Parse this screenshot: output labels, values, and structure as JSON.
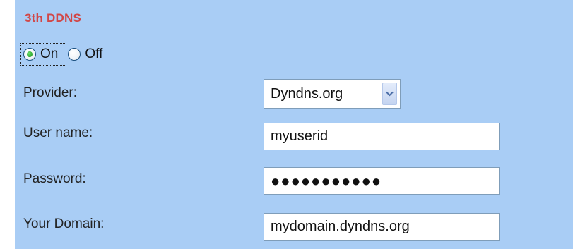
{
  "section": {
    "title": "3th DDNS"
  },
  "radio": {
    "on_label": "On",
    "off_label": "Off",
    "selected": "On"
  },
  "provider": {
    "label": "Provider:",
    "selected": "Dyndns.org"
  },
  "username": {
    "label": "User name:",
    "value": "myuserid"
  },
  "password": {
    "label": "Password:",
    "masked": "●●●●●●●●●●●"
  },
  "domain": {
    "label": "Your Domain:",
    "value": "mydomain.dyndns.org"
  },
  "colors": {
    "panel_background": "#a9cdf5",
    "title": "#d14747",
    "input_border": "#7f9db9"
  }
}
